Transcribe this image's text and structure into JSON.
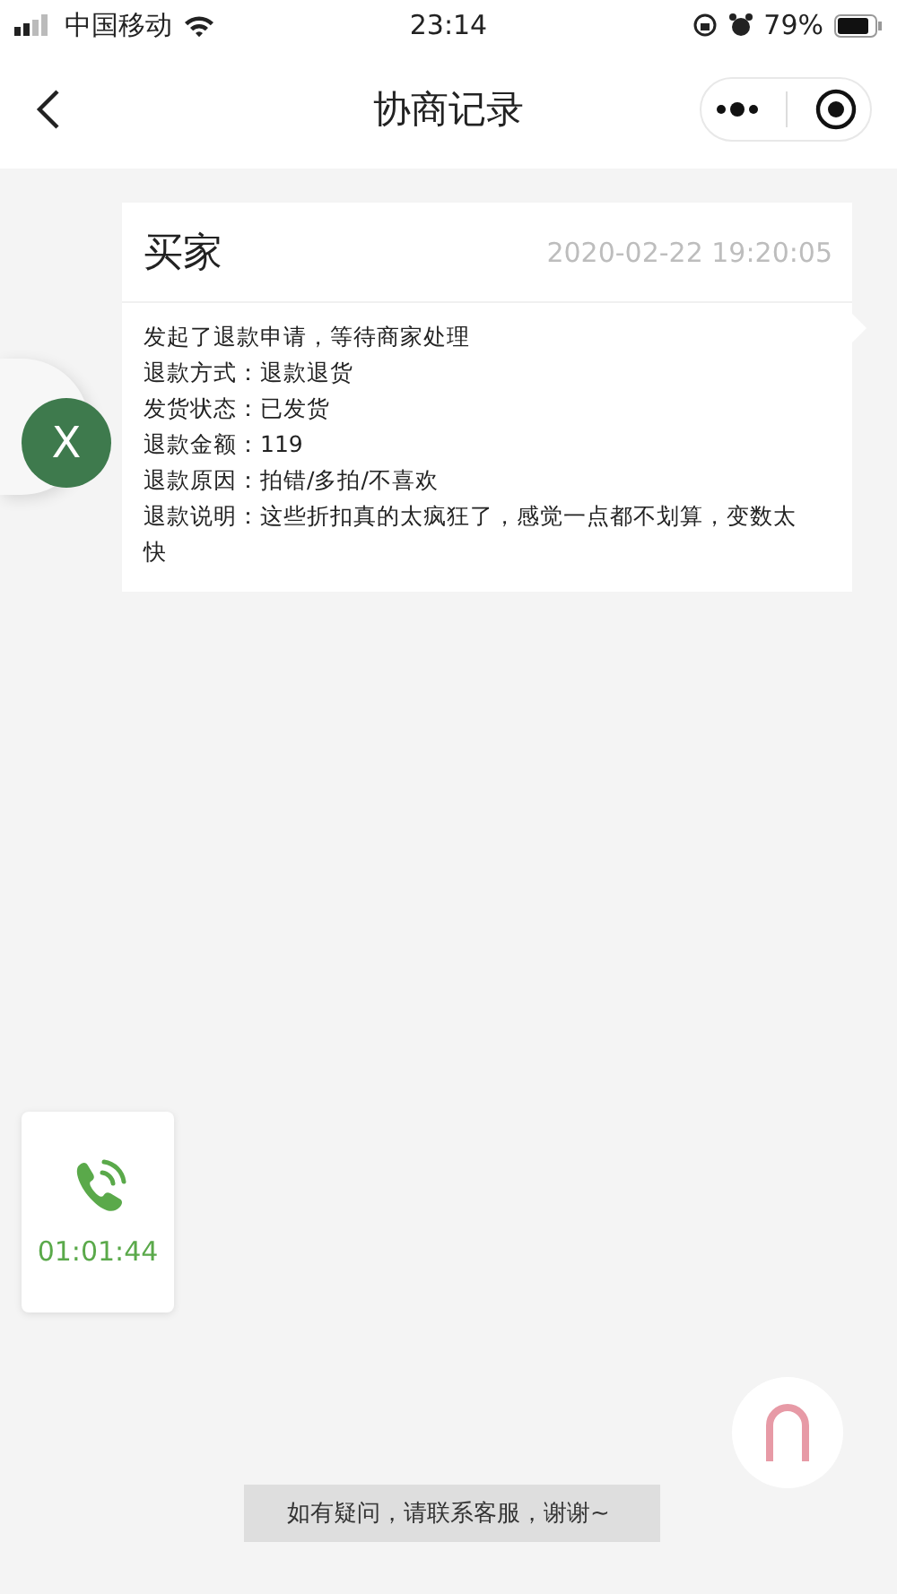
{
  "status_bar": {
    "carrier": "中国移动",
    "time": "23:14",
    "battery": "79%"
  },
  "nav": {
    "title": "协商记录"
  },
  "record": {
    "author": "买家",
    "timestamp": "2020-02-22 19:20:05",
    "lines": [
      "发起了退款申请，等待商家处理",
      "退款方式：退款退货",
      "发货状态：已发货",
      "退款金额：119",
      "退款原因：拍错/多拍/不喜欢",
      "退款说明：这些折扣真的太疯狂了，感觉一点都不划算，变数太快"
    ]
  },
  "floating_badge": {
    "letter": "X"
  },
  "call": {
    "duration": "01:01:44"
  },
  "toast": {
    "text": "如有疑问，请联系客服，谢谢~"
  }
}
